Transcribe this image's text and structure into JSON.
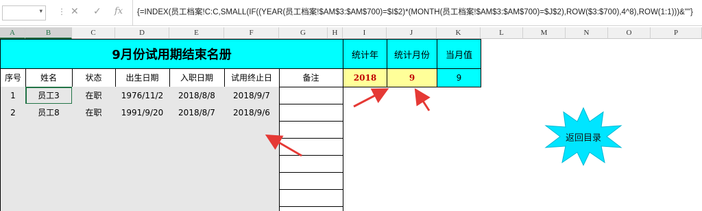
{
  "formula_bar": {
    "name_box": "",
    "cancel_icon": "✕",
    "enter_icon": "✓",
    "fx_label": "fx",
    "formula": "{=INDEX(员工档案!C:C,SMALL(IF((YEAR(员工档案!$AM$3:$AM$700)=$I$2)*(MONTH(员工档案!$AM$3:$AM$700)=$J$2),ROW($3:$700),4^8),ROW(1:1)))&\"\"}"
  },
  "columns": [
    "A",
    "B",
    "C",
    "D",
    "E",
    "F",
    "G",
    "H",
    "I",
    "J",
    "K",
    "L",
    "M",
    "N",
    "O",
    "P"
  ],
  "sheet": {
    "title": "9月份试用期结束名册",
    "headers": [
      "序号",
      "姓名",
      "状态",
      "出生日期",
      "入职日期",
      "试用终止日",
      "备注"
    ],
    "rows": [
      [
        "1",
        "员工3",
        "在职",
        "1976/11/2",
        "2018/8/8",
        "2018/9/7",
        ""
      ],
      [
        "2",
        "员工8",
        "在职",
        "1991/9/20",
        "2018/8/7",
        "2018/9/6",
        ""
      ]
    ],
    "stat_labels": [
      "统计年",
      "统计月份",
      "当月值"
    ],
    "stat_values": [
      "2018",
      "9",
      "9"
    ]
  },
  "return_button": "返回目录",
  "colors": {
    "cyan": "#00ffff",
    "yellow": "#ffff99",
    "red_text": "#c00000",
    "arrow": "#e53935",
    "selected": "#217346"
  }
}
